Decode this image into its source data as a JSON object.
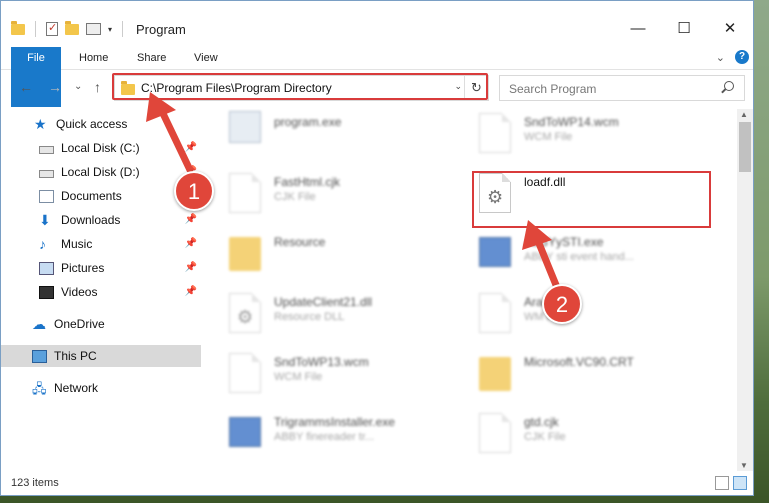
{
  "window": {
    "title": "Program",
    "controls": {
      "minimize": "—",
      "maximize": "☐",
      "close": "✕"
    }
  },
  "ribbon": {
    "tabs": [
      "File",
      "Home",
      "Share",
      "View"
    ],
    "expand": "⌄",
    "help": "?"
  },
  "nav": {
    "back": "←",
    "forward": "→",
    "recent": "⌄",
    "up": "↑"
  },
  "address": {
    "path": "C:\\Program Files\\Program Directory",
    "dropdown": "⌄",
    "refresh": "↻"
  },
  "search": {
    "placeholder": "Search Program"
  },
  "sidebar": {
    "items": [
      {
        "label": "Quick access",
        "icon": "star-icon"
      },
      {
        "label": "Local Disk (C:)",
        "icon": "drive-icon",
        "pinned": true
      },
      {
        "label": "Local Disk (D:)",
        "icon": "drive-icon",
        "pinned": true
      },
      {
        "label": "Documents",
        "icon": "documents-icon",
        "pinned": true
      },
      {
        "label": "Downloads",
        "icon": "download-icon",
        "pinned": true
      },
      {
        "label": "Music",
        "icon": "music-icon",
        "pinned": true
      },
      {
        "label": "Pictures",
        "icon": "pictures-icon",
        "pinned": true
      },
      {
        "label": "Videos",
        "icon": "videos-icon",
        "pinned": true
      },
      {
        "label": "OneDrive",
        "icon": "cloud-icon"
      },
      {
        "label": "This PC",
        "icon": "pc-icon",
        "selected": true
      },
      {
        "label": "Network",
        "icon": "network-icon"
      }
    ]
  },
  "files": [
    {
      "name": "program.exe",
      "type": "",
      "icon": "exe-icon"
    },
    {
      "name": "SndToWP14.wcm",
      "type": "WCM File",
      "icon": "document-icon"
    },
    {
      "name": "FastHtml.cjk",
      "type": "CJK File",
      "icon": "document-icon"
    },
    {
      "name": "loadf.dll",
      "type": "",
      "icon": "dll-gear-icon"
    },
    {
      "name": "Resource",
      "type": "",
      "icon": "folder-icon"
    },
    {
      "name": "ABBYySTI.exe",
      "type": "ABBY sti event hand...",
      "icon": "exe-icon"
    },
    {
      "name": "UpdateClient21.dll",
      "type": "Resource DLL",
      "icon": "dll-gear-icon"
    },
    {
      "name": "Arabic.fsl",
      "type": "WM File",
      "icon": "document-icon"
    },
    {
      "name": "SndToWP13.wcm",
      "type": "WCM File",
      "icon": "document-icon"
    },
    {
      "name": "Microsoft.VC90.CRT",
      "type": "",
      "icon": "folder-icon"
    },
    {
      "name": "TrigrammsInstaller.exe",
      "type": "ABBY finereader tr...",
      "icon": "exe-icon"
    },
    {
      "name": "gtd.cjk",
      "type": "CJK File",
      "icon": "document-icon"
    }
  ],
  "annotations": [
    {
      "label": "1",
      "color": "#e0463a"
    },
    {
      "label": "2",
      "color": "#e0463a"
    }
  ],
  "status": {
    "count": "123 items"
  }
}
